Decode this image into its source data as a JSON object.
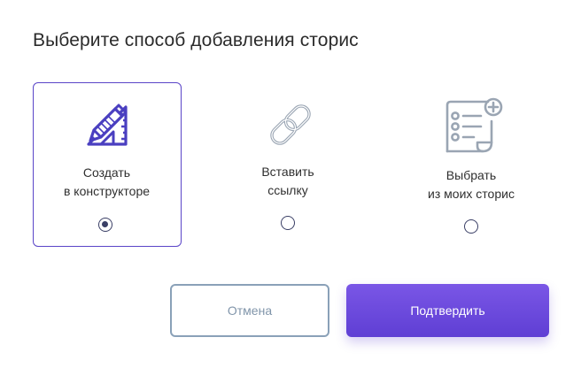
{
  "dialog": {
    "title": "Выберите способ добавления сторис"
  },
  "options": [
    {
      "id": "constructor",
      "icon": "pencil-ruler-icon",
      "line1": "Создать",
      "line2": "в конструкторе",
      "selected": true
    },
    {
      "id": "link",
      "icon": "chain-link-icon",
      "line1": "Вставить",
      "line2": "ссылку",
      "selected": false
    },
    {
      "id": "my-stories",
      "icon": "checklist-add-icon",
      "line1": "Выбрать",
      "line2": "из моих сторис",
      "selected": false
    }
  ],
  "buttons": {
    "cancel_label": "Отмена",
    "confirm_label": "Подтвердить"
  },
  "colors": {
    "accent": "#5a45c8",
    "icon_primary": "#4a3fc0",
    "icon_muted": "#9aa5b3",
    "button_gradient_top": "#7a56e6",
    "button_gradient_bottom": "#5f3fd4",
    "cancel_border": "#8aa1b8"
  }
}
